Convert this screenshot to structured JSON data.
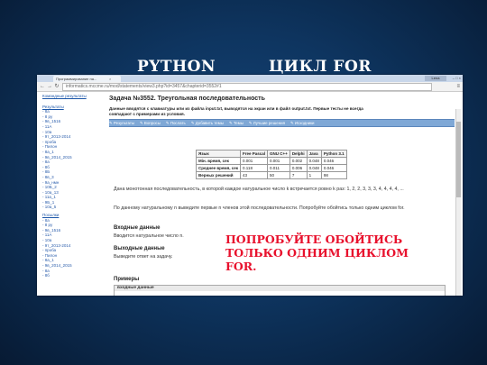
{
  "slide": {
    "title_left": "PYTHON",
    "title_right": "ЦИКЛ FOR"
  },
  "browser": {
    "tab_label": "Программирование на...",
    "tab_close": "×",
    "lang": "Lena",
    "window_buttons": "– □ ×",
    "address": "informatics.mccme.ru/mod/statements/view3.php?id=3457&chapterid=3552#1",
    "address_domain": "informatics.mccme.ru"
  },
  "sidebar": {
    "sections": [
      {
        "label": "Командные результаты",
        "items": []
      },
      {
        "label": "Результаты",
        "items": [
          "- 8а",
          "- 8 ру",
          "- 9в_1516",
          "- 11А",
          "- 10а",
          "- 9т_2013-2014",
          "- проба",
          "- Пилон",
          "- 8а_1",
          "- 9в_2014_2015",
          "- 8а",
          "- 8б",
          "- 8Б",
          "- 8в_3",
          "- 9а_нмн",
          "- 10Б_2",
          "- 10а_13",
          "- 11а_1",
          "- 9Б_1",
          "- 10а_5"
        ]
      },
      {
        "label": "Посылки",
        "items": [
          "- 8а",
          "- 8 ру",
          "- 9в_1516",
          "- 11А",
          "- 10а",
          "- 9т_2013-2014",
          "- проба",
          "- Пилон",
          "- 8а_1",
          "- 9в_2014_2015",
          "- 8а",
          "- 8б"
        ]
      }
    ]
  },
  "problem": {
    "title": "Задача №3552. Треугольная последовательность",
    "description": "Данные вводятся с клавиатуры или из файла input.txt, выводятся на экран или в файл output.txt. Первые тесты не всегда совпадают с примерами из условия.",
    "nav": [
      "Результаты",
      "Вопросы",
      "Послать",
      "Добавить темы",
      "Темы",
      "Лучшие решения",
      "Исходники"
    ],
    "limits_table": {
      "headers": [
        "Язык",
        "Free Pascal",
        "GNU C++",
        "Delphi",
        "Java",
        "Python 3.1"
      ],
      "rows": [
        [
          "Мін. время, сек",
          "0.001",
          "0.001",
          "0.002",
          "0.048",
          "0.046"
        ],
        [
          "Среднее время, сек",
          "0.118",
          "0.011",
          "0.006",
          "0.048",
          "0.046"
        ],
        [
          "Верных решений",
          "43",
          "50",
          "7",
          "1",
          "98"
        ]
      ]
    },
    "statement_1": "Дана монотонная последовательность, в которой каждое натуральное число k встречается ровно k раз: 1, 2, 2, 3, 3, 3, 4, 4, 4, 4, ...",
    "statement_2": "По данному натуральному n выведите первые n членов этой последовательности. Попробуйте обойтись только одним циклом for.",
    "input_heading": "Входные данные",
    "input_text": "Вводится натуральное число n.",
    "output_heading": "Выходные данные",
    "output_text": "Выведите ответ на задачу.",
    "examples_heading": "Примеры",
    "examples_table_header": "входные данные"
  },
  "overlay": {
    "text": "ПОПРОБУЙТЕ ОБОЙТИСЬ ТОЛЬКО ОДНИМ ЦИКЛОМ FOR."
  }
}
